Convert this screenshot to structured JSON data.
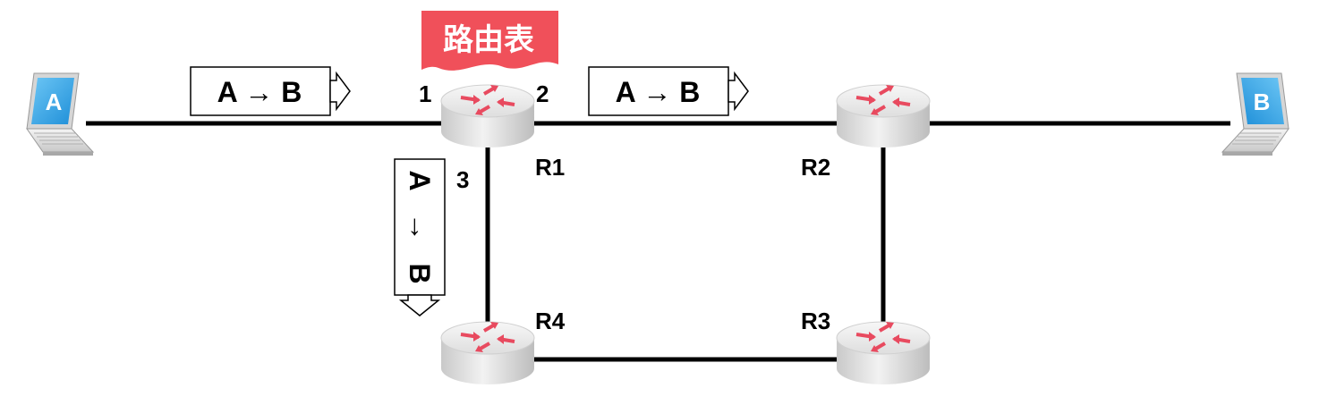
{
  "routing_table_label": "路由表",
  "hosts": {
    "a": "A",
    "b": "B"
  },
  "routers": {
    "r1": "R1",
    "r2": "R2",
    "r3": "R3",
    "r4": "R4"
  },
  "ports": {
    "p1": "1",
    "p2": "2",
    "p3": "3"
  },
  "packets": {
    "left": "A → B",
    "right": "A → B",
    "down_a": "A",
    "down_arrow": "→",
    "down_b": "B"
  },
  "colors": {
    "routing_table_fill": "#f0505a",
    "router_arrow": "#e84a5f",
    "laptop_screen": "#35a9ea",
    "link": "#000000"
  }
}
